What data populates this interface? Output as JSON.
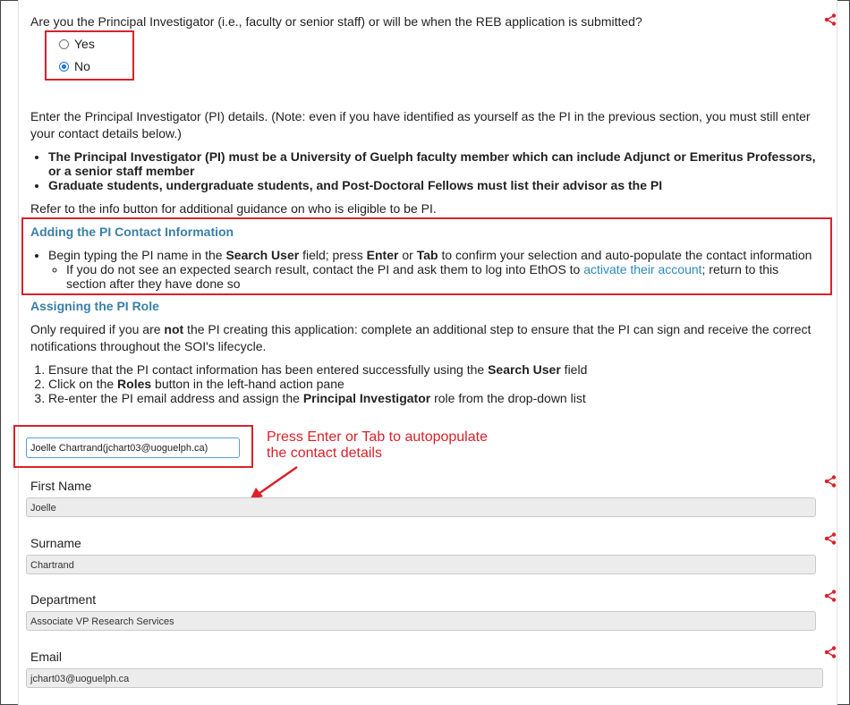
{
  "question": "Are you the Principal Investigator (i.e., faculty or senior staff) or will be when the REB application is submitted?",
  "options": [
    {
      "label": "Yes",
      "selected": false
    },
    {
      "label": "No",
      "selected": true
    }
  ],
  "intro": "Enter the Principal Investigator (PI) details. (Note: even if you have identified as yourself as the PI in the previous section, you must still enter your contact details below.)",
  "bullets": [
    "The Principal Investigator (PI) must be a University of Guelph faculty member which can include Adjunct or Emeritus Professors, or a senior staff member",
    "Graduate students, undergraduate students, and Post-Doctoral Fellows must list their advisor as the PI"
  ],
  "refer": "Refer to the info button for additional guidance on who is eligible to be PI.",
  "adding": {
    "heading": "Adding the PI Contact Information",
    "b1_pre": "Begin typing the PI name in the ",
    "b1_bold1": "Search User",
    "b1_mid": " field; press ",
    "b1_bold2": "Enter",
    "b1_or": " or ",
    "b1_bold3": "Tab",
    "b1_post": " to confirm your selection and auto-populate the contact information",
    "sub_pre": "If you do not see an expected search result, contact the PI and ask them to log into EthOS to ",
    "sub_link": "activate their account",
    "sub_post": "; return to this section after they have done so"
  },
  "assigning": {
    "heading": "Assigning the PI Role",
    "p_pre": "Only required if you are ",
    "p_bold": "not",
    "p_post": " the PI creating this application: complete an additional step to ensure that the PI can sign and receive the correct notifications throughout the SOI's lifecycle.",
    "s1_pre": "Ensure that the PI contact information has been entered successfully using the ",
    "s1_bold": "Search User",
    "s1_post": " field",
    "s2_pre": "Click on the ",
    "s2_bold": "Roles",
    "s2_post": " button in the left-hand action pane",
    "s3_pre": "Re-enter the PI email address and assign the ",
    "s3_bold": "Principal Investigator",
    "s3_post": " role from the drop-down list"
  },
  "search_value": "Joelle Chartrand(jchart03@uoguelph.ca)",
  "annotation": "Press Enter or Tab to autopopulate the contact details",
  "fields": {
    "first_name": {
      "label": "First Name",
      "value": "Joelle"
    },
    "surname": {
      "label": "Surname",
      "value": "Chartrand"
    },
    "department": {
      "label": "Department",
      "value": "Associate VP Research Services"
    },
    "email": {
      "label": "Email",
      "value": "jchart03@uoguelph.ca"
    }
  },
  "colors": {
    "highlight_red": "#d9222a",
    "heading_blue": "#3a7fa7",
    "link_blue": "#2a8abf"
  },
  "icons": [
    "share-icon"
  ]
}
